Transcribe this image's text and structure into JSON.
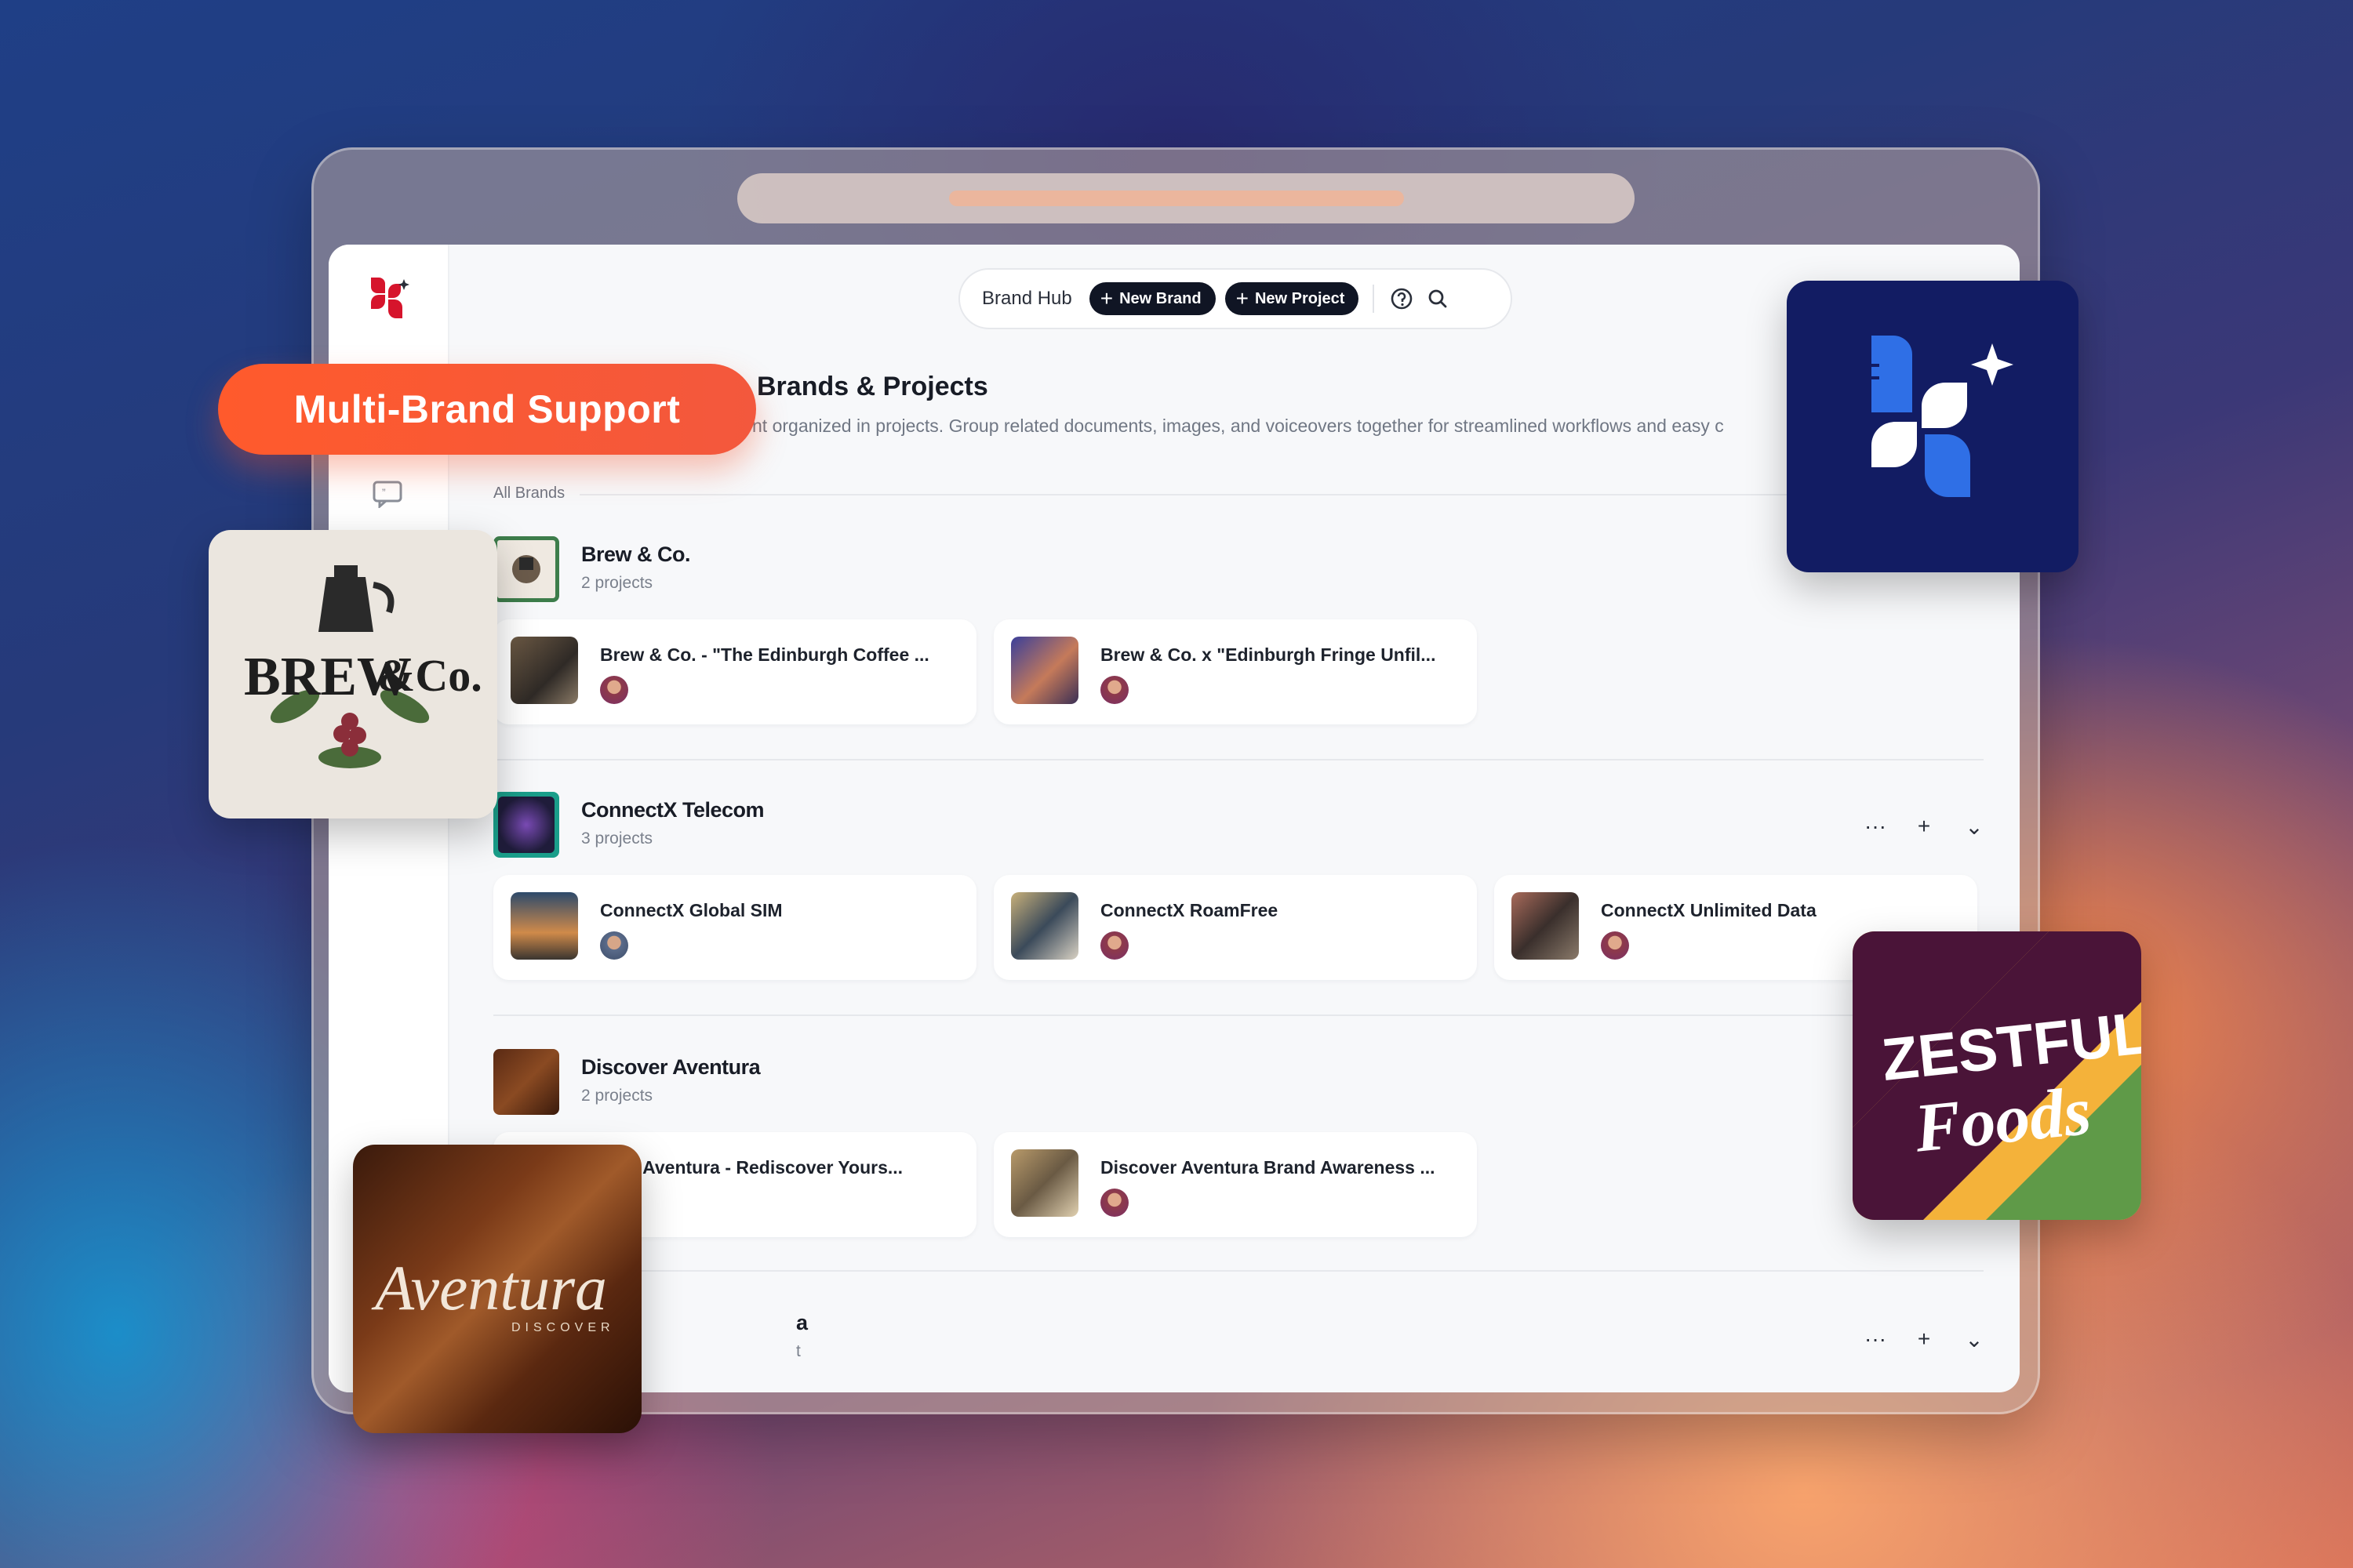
{
  "badge": {
    "label": "Multi-Brand Support"
  },
  "toolbar": {
    "title": "Brand Hub",
    "new_brand": "New Brand",
    "new_project": "New Project"
  },
  "page": {
    "title": "Brands & Projects",
    "description": "nt organized in projects. Group related documents, images, and voiceovers together for streamlined workflows and easy c",
    "section_label": "All Brands"
  },
  "brands": [
    {
      "name": "Brew & Co.",
      "count": "2 projects",
      "projects": [
        "Brew & Co. - \"The Edinburgh Coffee ...",
        "Brew & Co. x \"Edinburgh Fringe Unfil..."
      ]
    },
    {
      "name": "ConnectX Telecom",
      "count": "3 projects",
      "projects": [
        "ConnectX Global SIM",
        "ConnectX RoamFree",
        "ConnectX Unlimited Data"
      ]
    },
    {
      "name": "Discover Aventura",
      "count": "2 projects",
      "projects": [
        "over Aventura - Rediscover Yours...",
        "Discover Aventura Brand Awareness ..."
      ]
    },
    {
      "name": "a",
      "count": "t",
      "projects": []
    }
  ],
  "logos": {
    "brew_line1": "BREW",
    "brew_line2": "&Co.",
    "zestful_line1": "ZESTFUL",
    "zestful_line2": "Foods",
    "aventura_title": "Aventura",
    "aventura_sub": "DISCOVER"
  },
  "icons": [
    "brand-logo-icon",
    "chat-icon",
    "plus-icon",
    "help-icon",
    "search-icon",
    "more-icon",
    "chevron-down-icon"
  ]
}
